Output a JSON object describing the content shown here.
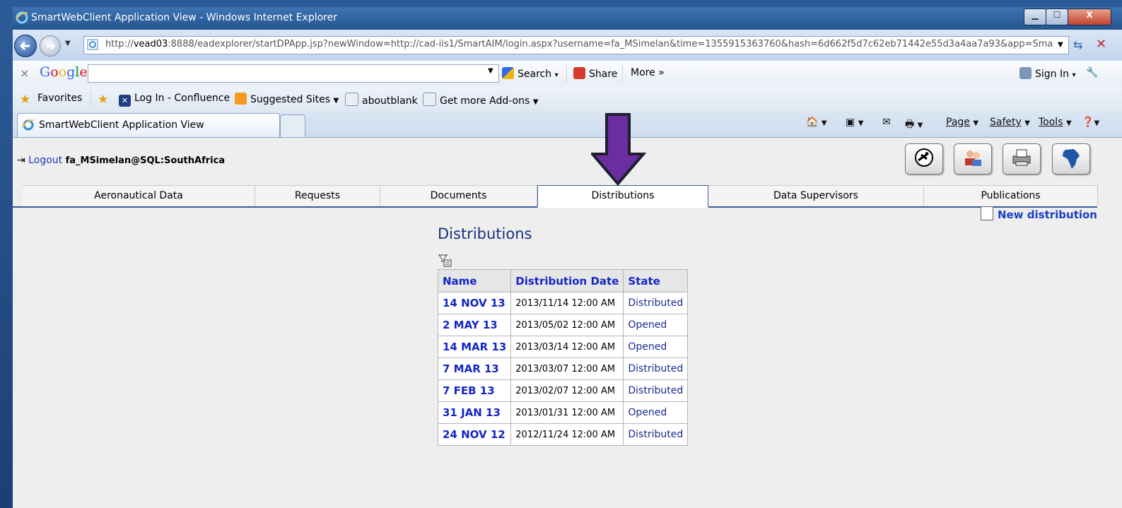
{
  "window": {
    "title": "SmartWebClient Application View - Windows Internet Explorer",
    "min_glyph": "▁",
    "max_glyph": "☐",
    "close_glyph": "X"
  },
  "address": {
    "url_prefix": "http://",
    "url_host": "vead03",
    "url_rest": ":8888/eadexplorer/startDPApp.jsp?newWindow=http://cad-iis1/SmartAIM/login.aspx?username=fa_MSimelan&time=1355915363760&hash=6d662f5d7c62eb71442e55d3a4aa7a93&app=Smart"
  },
  "google_toolbar": {
    "close": "×",
    "logo": "Google",
    "search": "Search",
    "share": "Share",
    "more": "More »",
    "sign_in": "Sign In"
  },
  "favorites": {
    "favorites": "Favorites",
    "items": [
      "Log In - Confluence",
      "Suggested Sites",
      "aboutblank",
      "Get more Add-ons"
    ]
  },
  "tabs": {
    "active_label": "SmartWebClient Application View"
  },
  "command_bar": {
    "page": "Page",
    "safety": "Safety",
    "tools": "Tools"
  },
  "app": {
    "logout_label": "Logout",
    "user": "fa_MSimelan@SQL:SouthAfrica",
    "nav_tabs": [
      "Aeronautical Data",
      "Requests",
      "Documents",
      "Distributions",
      "Data Supervisors",
      "Publications"
    ],
    "active_tab": "Distributions",
    "new_distribution": "New distribution",
    "section_title": "Distributions"
  },
  "table": {
    "headers": [
      "Name",
      "Distribution Date",
      "State"
    ],
    "rows": [
      [
        "14 NOV 13",
        "2013/11/14 12:00 AM",
        "Distributed"
      ],
      [
        "2 MAY 13",
        "2013/05/02 12:00 AM",
        "Opened"
      ],
      [
        "14 MAR 13",
        "2013/03/14 12:00 AM",
        "Opened"
      ],
      [
        "7 MAR 13",
        "2013/03/07 12:00 AM",
        "Distributed"
      ],
      [
        "7 FEB 13",
        "2013/02/07 12:00 AM",
        "Distributed"
      ],
      [
        "31 JAN 13",
        "2013/01/31 12:00 AM",
        "Opened"
      ],
      [
        "24 NOV 12",
        "2012/11/24 12:00 AM",
        "Distributed"
      ]
    ]
  },
  "colors": {
    "link": "#1526c7",
    "annotation_arrow": "#6a2ea0",
    "tab_border": "#3b5e99"
  }
}
